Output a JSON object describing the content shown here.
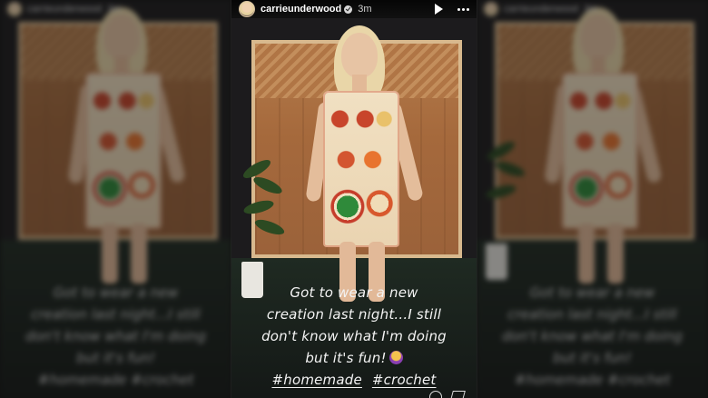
{
  "story": {
    "username": "carrieunderwood",
    "timestamp": "3m",
    "caption_lines": [
      "Got to wear a new",
      "creation last night...I still",
      "don't know what I'm doing",
      "but it's fun!"
    ],
    "hashtags": [
      "#homemade",
      "#crochet"
    ],
    "icons": {
      "avatar": "profile-avatar",
      "verified": "verified-badge-icon",
      "play": "play-icon",
      "more": "more-options-icon",
      "emoji": "person-shrugging-emoji-icon",
      "like": "heart-icon",
      "share": "send-icon"
    }
  },
  "side_left": {
    "username": "carrieunderwood",
    "timestamp": "3m",
    "caption_lines": [
      "Got to wear a new",
      "creation last night...I still",
      "don't know what I'm doing",
      "but it's fun!",
      "#homemade #crochet"
    ]
  },
  "side_right": {
    "username": "carrieunderwood",
    "timestamp": "3m",
    "caption_lines": [
      "Got to wear a new",
      "creation last night...I still",
      "don't know what I'm doing",
      "but it's fun!",
      "#homemade #crochet"
    ]
  },
  "colors": {
    "background": "#111111",
    "caption_text": "#f3f3f3",
    "wood_panel": "#a5693c",
    "dress_red": "#c8452b",
    "dress_cream": "#f1e0c2",
    "dress_green": "#2f8a3a"
  }
}
